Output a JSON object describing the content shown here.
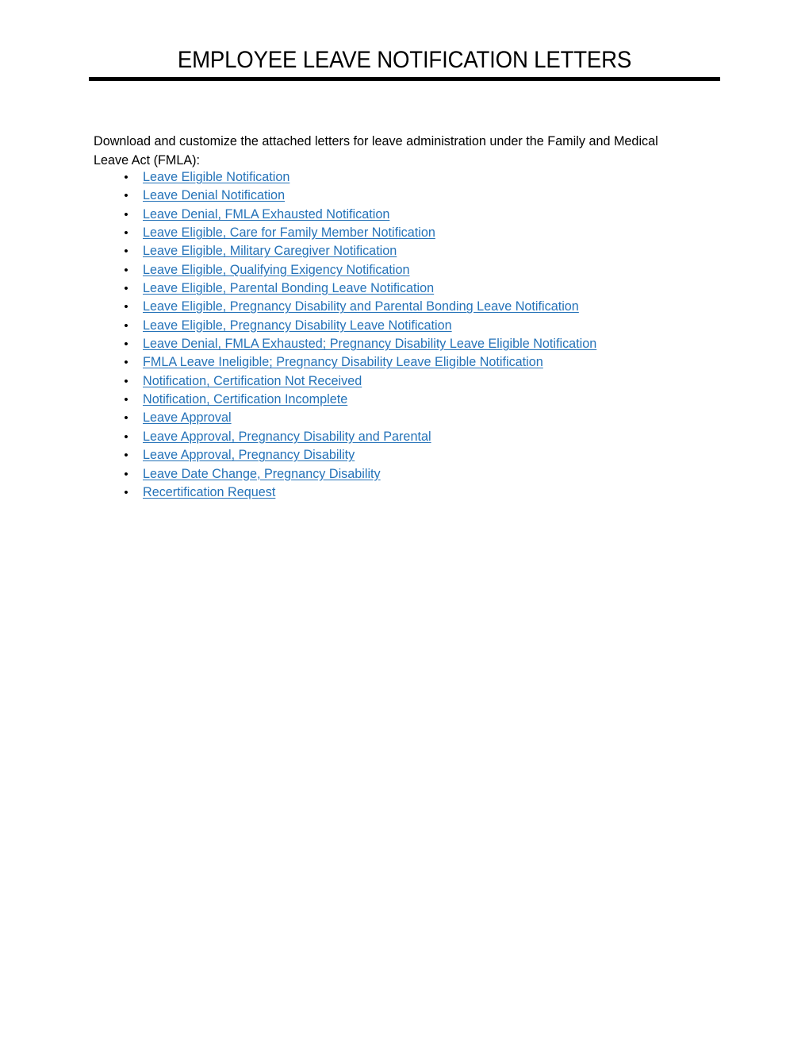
{
  "document": {
    "title": "EMPLOYEE LEAVE NOTIFICATION LETTERS",
    "intro": "Download and customize the attached letters for leave administration under the Family and Medical Leave Act (FMLA):",
    "bullet_glyph": "•",
    "link_color": "#2472B8",
    "text_color": "#000000",
    "rule_color": "#000000",
    "links": [
      {
        "label": "Leave Eligible Notification"
      },
      {
        "label": "Leave Denial Notification"
      },
      {
        "label": "Leave Denial, FMLA Exhausted Notification"
      },
      {
        "label": "Leave Eligible, Care for Family Member Notification"
      },
      {
        "label": "Leave Eligible, Military Caregiver Notification"
      },
      {
        "label": "Leave Eligible, Qualifying Exigency Notification"
      },
      {
        "label": "Leave Eligible, Parental Bonding Leave Notification"
      },
      {
        "label": "Leave Eligible, Pregnancy Disability and Parental Bonding Leave Notification"
      },
      {
        "label": "Leave Eligible, Pregnancy Disability Leave Notification"
      },
      {
        "label": "Leave Denial, FMLA Exhausted; Pregnancy Disability Leave Eligible Notification"
      },
      {
        "label": "FMLA Leave Ineligible; Pregnancy Disability Leave Eligible Notification"
      },
      {
        "label": "Notification, Certification Not Received"
      },
      {
        "label": "Notification, Certification Incomplete "
      },
      {
        "label": "Leave Approval"
      },
      {
        "label": "Leave Approval, Pregnancy Disability and Parental "
      },
      {
        "label": "Leave Approval, Pregnancy Disability "
      },
      {
        "label": "Leave Date Change, Pregnancy Disability"
      },
      {
        "label": "Recertification Request"
      }
    ]
  }
}
